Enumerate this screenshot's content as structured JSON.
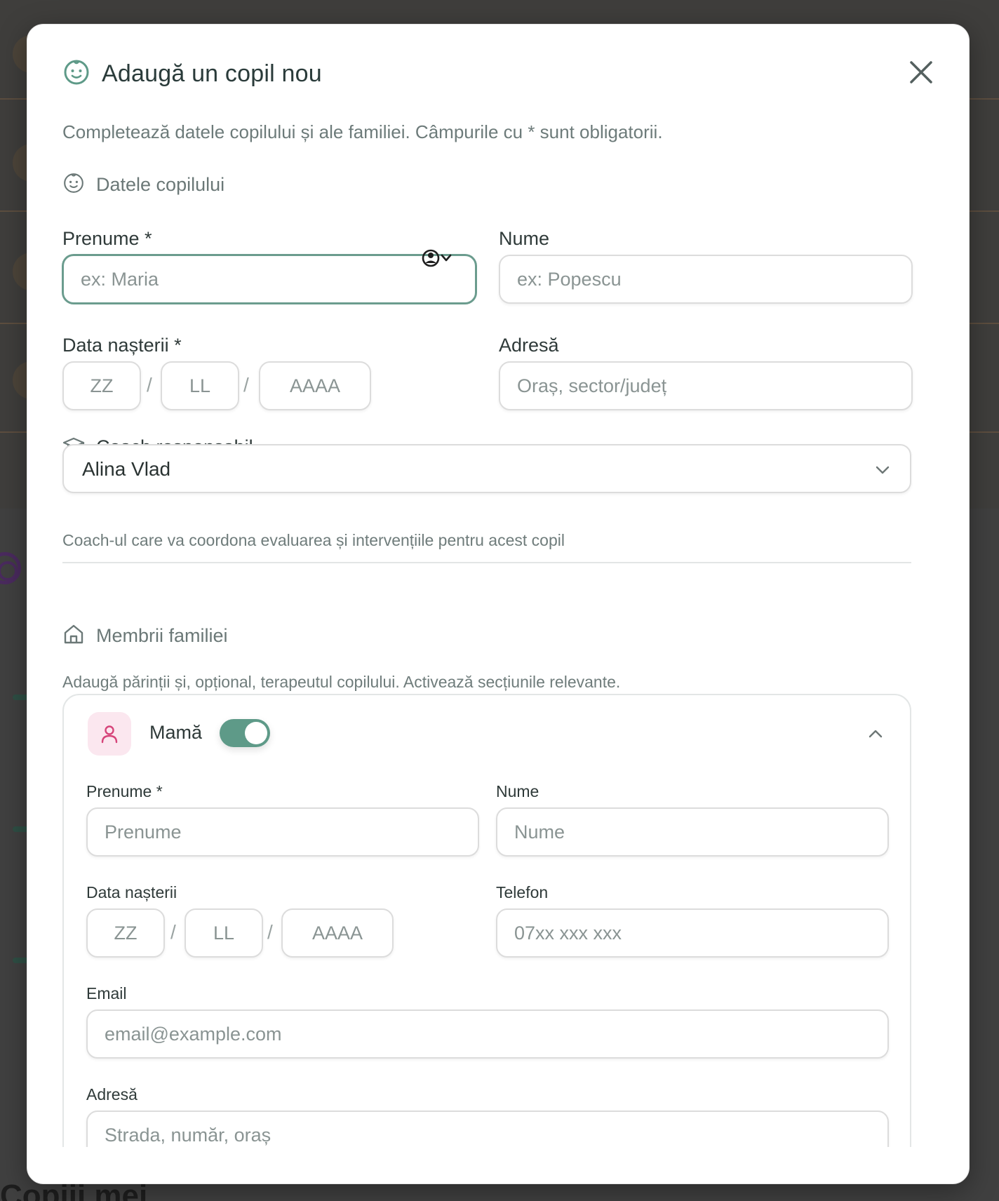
{
  "modal": {
    "title": "Adaugă un copil nou",
    "subtitle": "Completează datele copilului și ale familiei. Câmpurile cu * sunt obligatorii."
  },
  "child_section": {
    "heading": "Datele copilului",
    "first_name": {
      "label": "Prenume *",
      "placeholder": "ex: Maria"
    },
    "last_name": {
      "label": "Nume",
      "placeholder": "ex: Popescu"
    },
    "birth_date": {
      "label": "Data nașterii *",
      "day_placeholder": "ZZ",
      "month_placeholder": "LL",
      "year_placeholder": "AAAA",
      "separator": "/"
    },
    "address": {
      "label": "Adresă",
      "placeholder": "Oraș, sector/județ"
    }
  },
  "coach": {
    "label": "Coach responsabil",
    "selected": "Alina Vlad",
    "helper": "Coach-ul care va coordona evaluarea și intervențiile pentru acest copil"
  },
  "family_section": {
    "heading": "Membrii familiei",
    "helper": "Adaugă părinții și, opțional, terapeutul copilului. Activează secțiunile relevante.",
    "member": {
      "name": "Mamă",
      "enabled": true,
      "first_name": {
        "label": "Prenume *",
        "placeholder": "Prenume"
      },
      "last_name": {
        "label": "Nume",
        "placeholder": "Nume"
      },
      "birth_date": {
        "label": "Data nașterii",
        "day_placeholder": "ZZ",
        "month_placeholder": "LL",
        "year_placeholder": "AAAA"
      },
      "phone": {
        "label": "Telefon",
        "placeholder": "07xx xxx xxx"
      },
      "email": {
        "label": "Email",
        "placeholder": "email@example.com"
      },
      "address": {
        "label": "Adresă",
        "placeholder": "Strada, număr, oraș"
      }
    }
  },
  "background": {
    "page_title": "Copiii mei"
  },
  "colors": {
    "accent": "#5e9a88",
    "focus_border": "#6b9c8e",
    "member_avatar_bg": "#fbe7ef",
    "member_icon": "#d6457a"
  }
}
